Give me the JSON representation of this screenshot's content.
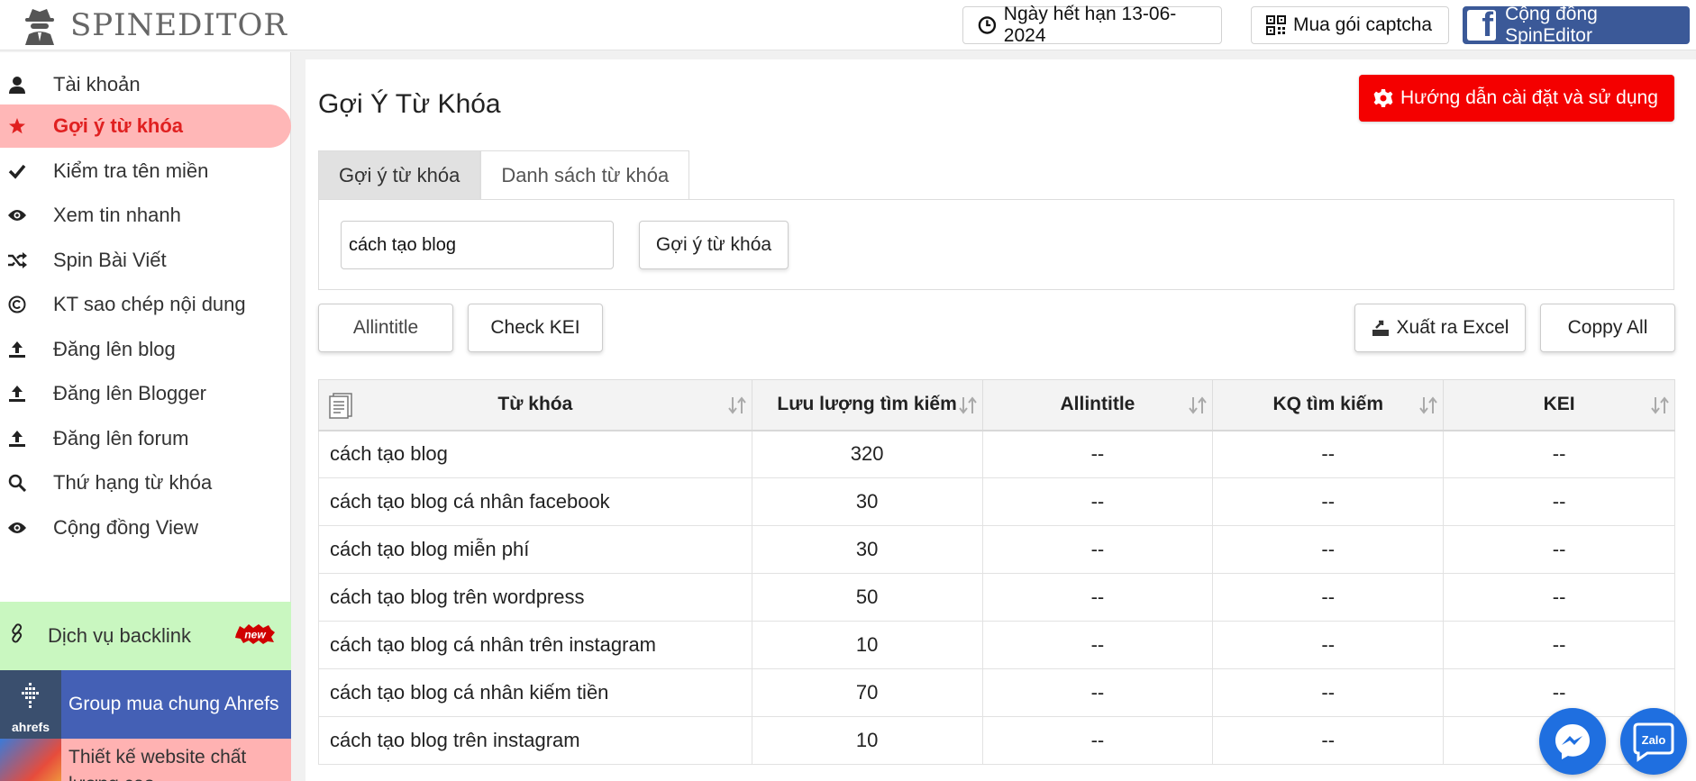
{
  "header": {
    "brand": "SPINEDITOR",
    "expire_label": "Ngày hết hạn 13-06-2024",
    "captcha_label": "Mua gói captcha",
    "community_label": "Cộng đồng SpinEditor"
  },
  "sidebar": {
    "items": [
      {
        "label": "Tài khoản",
        "icon": "user-icon"
      },
      {
        "label": "Gợi ý từ khóa",
        "icon": "star-icon"
      },
      {
        "label": "Kiểm tra tên miền",
        "icon": "check-icon"
      },
      {
        "label": "Xem tin nhanh",
        "icon": "eye-icon"
      },
      {
        "label": "Spin Bài Viết",
        "icon": "shuffle-icon"
      },
      {
        "label": "KT sao chép nội dung",
        "icon": "copyright-icon"
      },
      {
        "label": "Đăng lên blog",
        "icon": "upload-icon"
      },
      {
        "label": "Đăng lên Blogger",
        "icon": "upload-icon"
      },
      {
        "label": "Đăng lên forum",
        "icon": "upload-icon"
      },
      {
        "label": "Thứ hạng từ khóa",
        "icon": "search-icon"
      },
      {
        "label": "Cộng đồng View",
        "icon": "eye-icon"
      }
    ],
    "backlink_label": "Dịch vụ backlink",
    "new_badge": "new",
    "ahrefs_logo_text": "ahrefs",
    "ahrefs_label": "Group mua chung Ahrefs",
    "website_label": "Thiết kế website chất lượng cao"
  },
  "main": {
    "title": "Gợi Ý Từ Khóa",
    "help_button": "Hướng dẫn cài đặt và sử dụng",
    "tabs": [
      "Gợi ý từ khóa",
      "Danh sách từ khóa"
    ],
    "keyword_input": "cách tạo blog",
    "suggest_button": "Gợi ý từ khóa",
    "allintitle_button": "Allintitle",
    "kei_button": "Check KEI",
    "excel_button": "Xuất ra Excel",
    "copy_button": "Coppy All"
  },
  "table": {
    "headers": [
      "Từ khóa",
      "Lưu lượng tìm kiếm",
      "Allintitle",
      "KQ tìm kiếm",
      "KEI"
    ],
    "rows": [
      [
        "cách tạo blog",
        "320",
        "--",
        "--",
        "--"
      ],
      [
        "cách tạo blog cá nhân facebook",
        "30",
        "--",
        "--",
        "--"
      ],
      [
        "cách tạo blog miễn phí",
        "30",
        "--",
        "--",
        "--"
      ],
      [
        "cách tạo blog trên wordpress",
        "50",
        "--",
        "--",
        "--"
      ],
      [
        "cách tạo blog cá nhân trên instagram",
        "10",
        "--",
        "--",
        "--"
      ],
      [
        "cách tạo blog cá nhân kiếm tiền",
        "70",
        "--",
        "--",
        "--"
      ],
      [
        "cách tạo blog trên instagram",
        "10",
        "--",
        "--",
        "--"
      ]
    ]
  },
  "floating": {
    "zalo_label": "Zalo"
  },
  "colors": {
    "accent_red": "#f40000",
    "active_bg": "#ffb7b7",
    "facebook_blue": "#3b5998",
    "backlink_green": "#c9f7c0",
    "ahrefs_blue": "#4460b5",
    "fab_blue": "#1f6fe0"
  }
}
